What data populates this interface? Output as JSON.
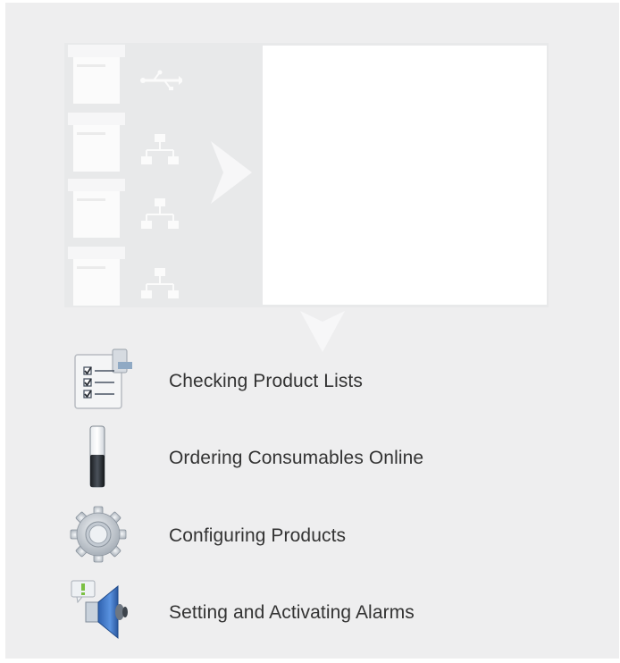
{
  "features": [
    {
      "label": "Checking Product Lists",
      "icon": "checklist-icon"
    },
    {
      "label": "Ordering Consumables Online",
      "icon": "toner-level-icon"
    },
    {
      "label": "Configuring Products",
      "icon": "gear-icon"
    },
    {
      "label": "Setting and Activating Alarms",
      "icon": "alarm-speaker-icon"
    }
  ],
  "colors": {
    "background": "#eeeeef",
    "panel": "#ffffff",
    "text": "#333333",
    "alarm_blue": "#3a78c8",
    "alarm_green": "#7bc043"
  }
}
